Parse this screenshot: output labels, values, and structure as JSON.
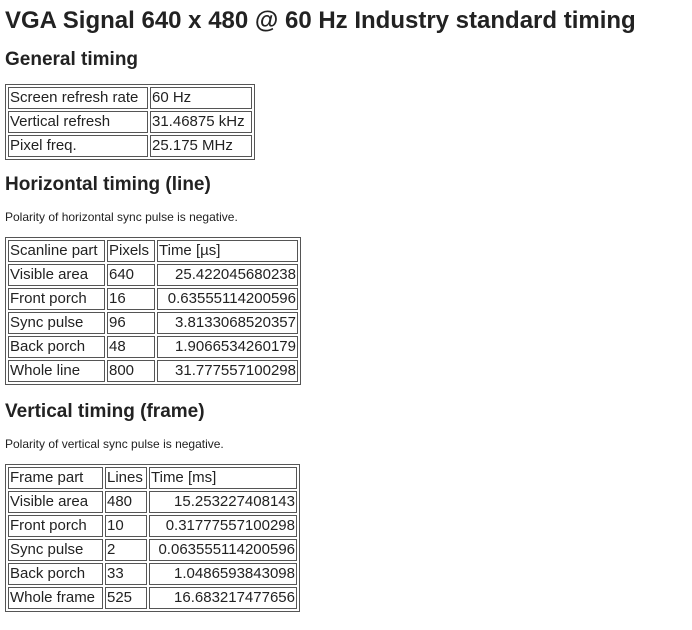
{
  "title": "VGA Signal 640 x 480 @ 60 Hz Industry standard timing",
  "general": {
    "heading": "General timing",
    "rows": [
      [
        "Screen refresh rate",
        "60 Hz"
      ],
      [
        "Vertical refresh",
        "31.46875 kHz"
      ],
      [
        "Pixel freq.",
        "25.175 MHz"
      ]
    ]
  },
  "horizontal": {
    "heading": "Horizontal timing (line)",
    "note": "Polarity of horizontal sync pulse is negative.",
    "headers": [
      "Scanline part",
      "Pixels",
      "Time [µs]"
    ],
    "rows": [
      [
        "Visible area",
        "640",
        "25.422045680238"
      ],
      [
        "Front porch",
        "16",
        "0.63555114200596"
      ],
      [
        "Sync pulse",
        "96",
        "3.8133068520357"
      ],
      [
        "Back porch",
        "48",
        "1.9066534260179"
      ],
      [
        "Whole line",
        "800",
        "31.777557100298"
      ]
    ]
  },
  "vertical": {
    "heading": "Vertical timing (frame)",
    "note": "Polarity of vertical sync pulse is negative.",
    "headers": [
      "Frame part",
      "Lines",
      "Time [ms]"
    ],
    "rows": [
      [
        "Visible area",
        "480",
        "15.253227408143"
      ],
      [
        "Front porch",
        "10",
        "0.31777557100298"
      ],
      [
        "Sync pulse",
        "2",
        "0.063555114200596"
      ],
      [
        "Back porch",
        "33",
        "1.0486593843098"
      ],
      [
        "Whole frame",
        "525",
        "16.683217477656"
      ]
    ]
  }
}
